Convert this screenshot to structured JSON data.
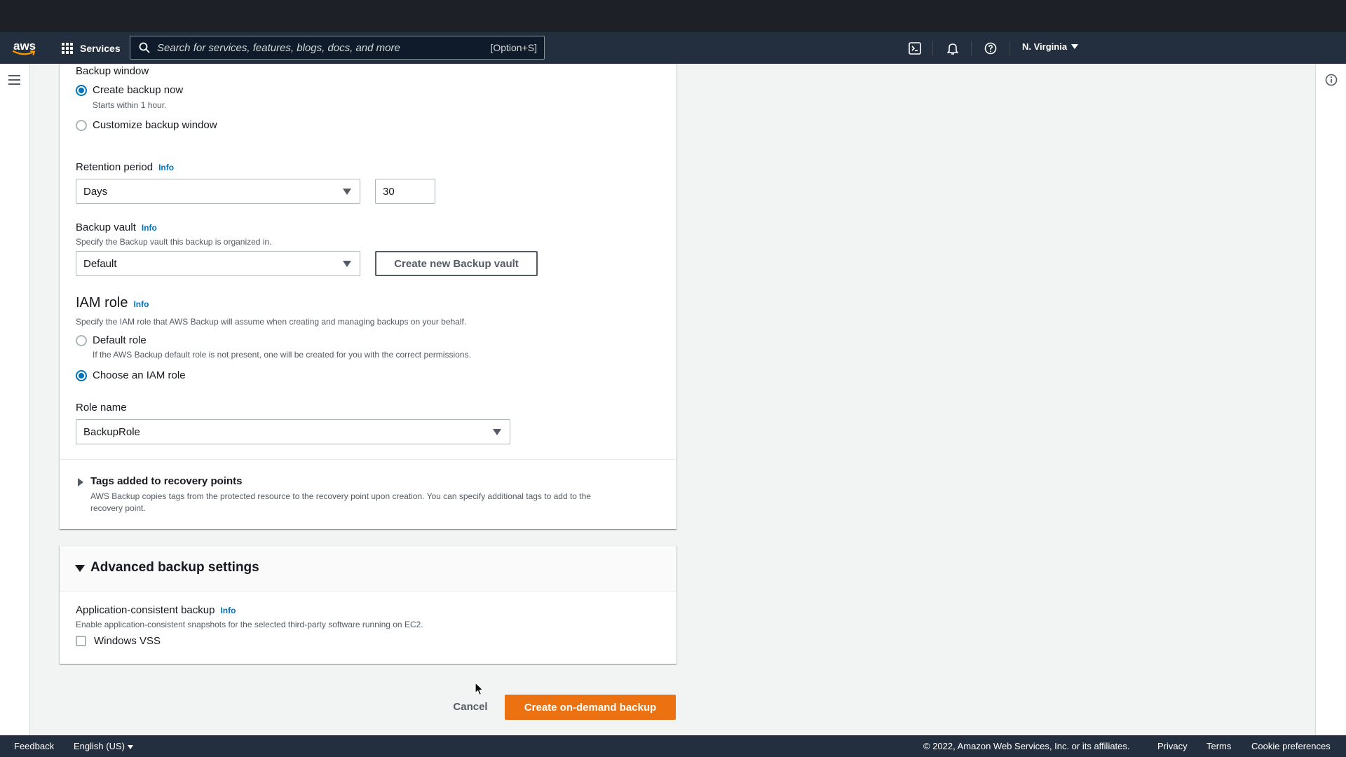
{
  "nav": {
    "logo_text": "aws",
    "services_label": "Services",
    "search_placeholder": "Search for services, features, blogs, docs, and more",
    "search_shortcut": "[Option+S]",
    "region_label": "N. Virginia"
  },
  "form": {
    "backup_window": {
      "label": "Backup window",
      "option_now": "Create backup now",
      "option_now_desc": "Starts within 1 hour.",
      "option_custom": "Customize backup window"
    },
    "retention": {
      "label": "Retention period",
      "info": "Info",
      "unit_value": "Days",
      "amount_value": "30"
    },
    "vault": {
      "label": "Backup vault",
      "info": "Info",
      "desc": "Specify the Backup vault this backup is organized in.",
      "selected": "Default",
      "create_button": "Create new Backup vault"
    },
    "iam": {
      "title": "IAM role",
      "info": "Info",
      "desc": "Specify the IAM role that AWS Backup will assume when creating and managing backups on your behalf.",
      "option_default": "Default role",
      "option_default_desc": "If the AWS Backup default role is not present, one will be created for you with the correct permissions.",
      "option_choose": "Choose an IAM role",
      "role_name_label": "Role name",
      "role_name_value": "BackupRole"
    },
    "tags": {
      "title": "Tags added to recovery points",
      "desc_line1": "AWS Backup copies tags from the protected resource to the recovery point upon creation. You can specify additional tags to add to the",
      "desc_line2": "recovery point."
    },
    "advanced": {
      "title": "Advanced backup settings",
      "app_consistent_label": "Application-consistent backup",
      "info": "Info",
      "app_consistent_desc": "Enable application-consistent snapshots for the selected third-party software running on EC2.",
      "windows_vss": "Windows VSS"
    },
    "actions": {
      "cancel": "Cancel",
      "submit": "Create on-demand backup"
    }
  },
  "footer": {
    "feedback": "Feedback",
    "language": "English (US)",
    "copyright": "© 2022, Amazon Web Services, Inc. or its affiliates.",
    "privacy": "Privacy",
    "terms": "Terms",
    "cookie": "Cookie preferences"
  },
  "colors": {
    "primary": "#ec7211",
    "link": "#0073bb",
    "nav_bg": "#232f3e"
  }
}
